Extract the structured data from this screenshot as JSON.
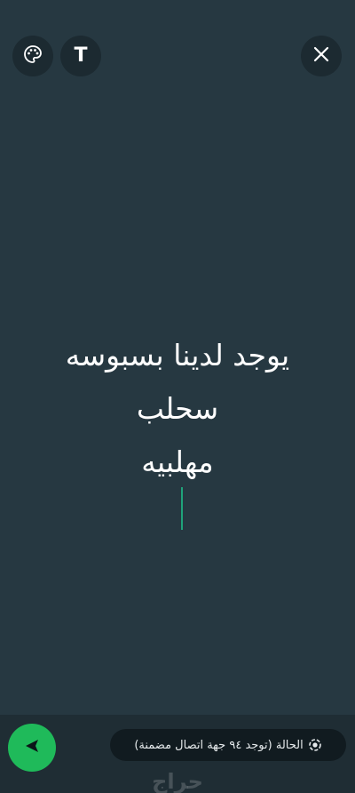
{
  "toolbar": {
    "palette_icon": "palette-icon",
    "text_icon": "text-format-icon",
    "text_glyph": "T",
    "close_icon": "close-icon"
  },
  "status": {
    "lines": [
      "يوجد لدينا بسبوسه",
      "سحلب",
      "مهلبيه"
    ],
    "background_color": "#263841",
    "text_color": "#ffffff",
    "cursor_color": "#1fa37a"
  },
  "footer": {
    "privacy_label": "الحالة (توجد ٩٤ جهة اتصال مضمنة)",
    "privacy_icon": "status-icon",
    "send_icon": "send-icon",
    "send_color": "#1fba5a"
  },
  "watermark": {
    "text": "حراج"
  }
}
